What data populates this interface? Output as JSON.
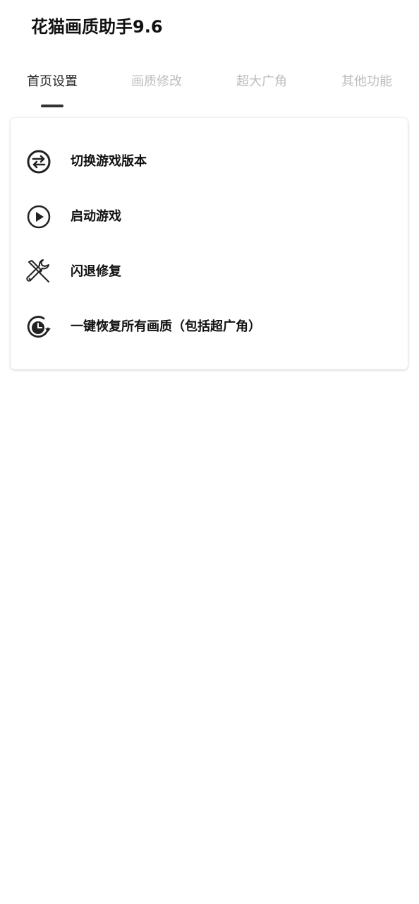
{
  "app": {
    "title": "花猫画质助手9.6"
  },
  "tabs": [
    {
      "label": "首页设置",
      "active": true
    },
    {
      "label": "画质修改",
      "active": false
    },
    {
      "label": "超大广角",
      "active": false
    },
    {
      "label": "其他功能",
      "active": false
    }
  ],
  "menu": {
    "items": [
      {
        "label": "切换游戏版本",
        "icon": "swap-arrows-icon"
      },
      {
        "label": "启动游戏",
        "icon": "play-circle-icon"
      },
      {
        "label": "闪退修复",
        "icon": "tools-repair-icon"
      },
      {
        "label": "一键恢复所有画质（包括超广角）",
        "icon": "restore-clock-icon"
      }
    ]
  },
  "colors": {
    "active_tab": "#222222",
    "inactive_tab": "#bdbdbd",
    "indicator": "#333333",
    "background": "#ffffff"
  }
}
